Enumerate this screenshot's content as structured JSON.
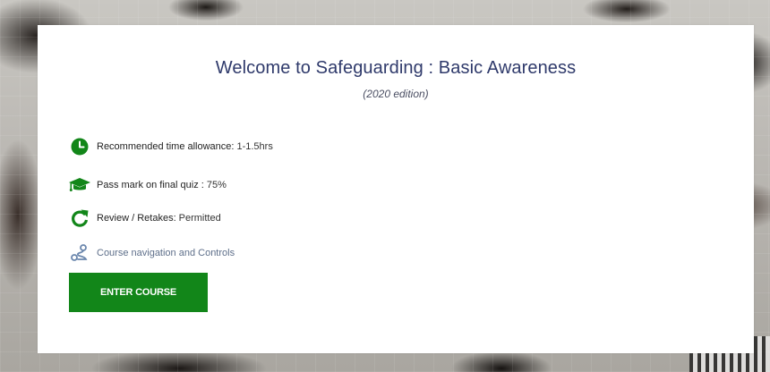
{
  "course": {
    "title": "Welcome to Safeguarding : Basic Awareness",
    "edition": "(2020 edition)"
  },
  "info_rows": [
    {
      "icon": "clock-icon",
      "label": "Recommended time allowance:",
      "value": "1-1.5hrs"
    },
    {
      "icon": "graduation-cap-icon",
      "label": "Pass mark on final quiz :",
      "value": "75%"
    },
    {
      "icon": "refresh-icon",
      "label": "Review / Retakes:",
      "value": "Permitted"
    }
  ],
  "navigation_link": {
    "icon": "route-icon",
    "label": "Course navigation and Controls"
  },
  "enter_button": {
    "label": "ENTER COURSE"
  },
  "colors": {
    "accent_green": "#128619",
    "title_navy": "#2f3a6b",
    "link_slate": "#5e6f8a"
  }
}
